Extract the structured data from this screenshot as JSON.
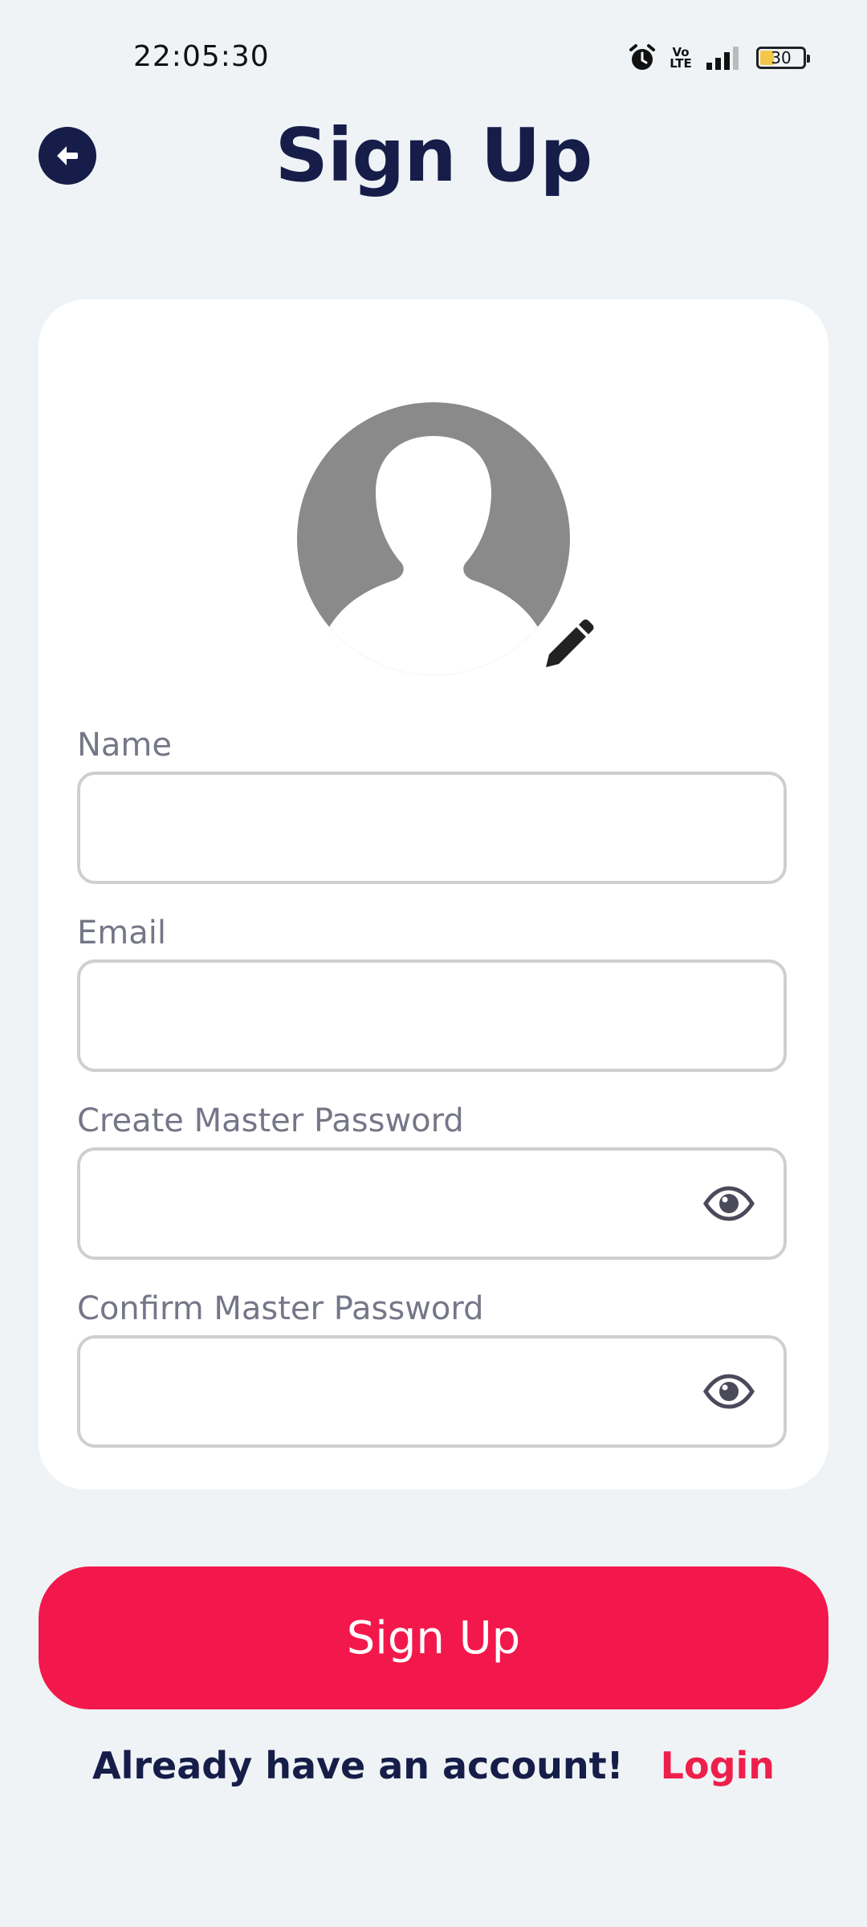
{
  "status_bar": {
    "time": "22:05:30",
    "volte_label": "Vo LTE",
    "battery_level": "30"
  },
  "header": {
    "title": "Sign Up"
  },
  "form": {
    "fields": [
      {
        "label": "Name",
        "value": ""
      },
      {
        "label": "Email",
        "value": ""
      },
      {
        "label": "Create Master Password",
        "value": ""
      },
      {
        "label": "Confirm Master Password",
        "value": ""
      }
    ]
  },
  "actions": {
    "signup_label": "Sign Up",
    "footer_text": "Already have an account!",
    "login_label": "Login"
  },
  "colors": {
    "background": "#eff3f6",
    "primary": "#f3184b",
    "navy": "#151d48",
    "label_gray": "#757788"
  }
}
